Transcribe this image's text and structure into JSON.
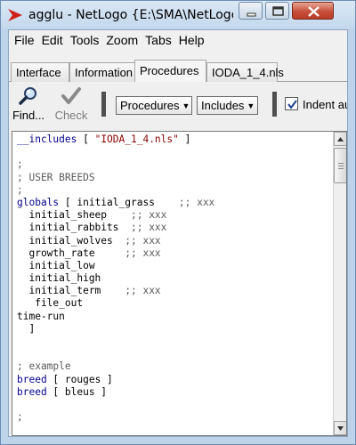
{
  "window": {
    "title": "agglu - NetLogo {E:\\SMA\\NetLogo",
    "buttons": {
      "minimize": "minimize-icon",
      "maximize": "maximize-icon",
      "close": "close-icon"
    },
    "colors": {
      "titlebar": "#c3d7ec",
      "close": "#c7503b",
      "app_icon": "#d0201a"
    }
  },
  "menu": {
    "items": [
      "File",
      "Edit",
      "Tools",
      "Zoom",
      "Tabs",
      "Help"
    ]
  },
  "tabs": {
    "items": [
      "Interface",
      "Information",
      "Procedures",
      "IODA_1_4.nls"
    ],
    "active": "Procedures"
  },
  "toolbar": {
    "find_label": "Find...",
    "check_label": "Check",
    "procedures_dropdown": "Procedures",
    "includes_dropdown": "Includes",
    "indent_label": "Indent automatically",
    "indent_checked": true
  },
  "editor": {
    "lines": [
      [
        {
          "t": "__includes",
          "c": "kw"
        },
        {
          "t": " [ ",
          "c": ""
        },
        {
          "t": "\"IODA_1_4.nls\"",
          "c": "str"
        },
        {
          "t": " ]",
          "c": ""
        }
      ],
      [],
      [
        {
          "t": ";",
          "c": "cm"
        }
      ],
      [
        {
          "t": "; USER BREEDS",
          "c": "cm"
        }
      ],
      [
        {
          "t": ";",
          "c": "cm"
        }
      ],
      [
        {
          "t": "globals",
          "c": "kw"
        },
        {
          "t": " [ initial_grass    ",
          "c": ""
        },
        {
          "t": ";; xxx",
          "c": "cm"
        }
      ],
      [
        {
          "t": "  initial_sheep    ",
          "c": ""
        },
        {
          "t": ";; xxx",
          "c": "cm"
        }
      ],
      [
        {
          "t": "  initial_rabbits  ",
          "c": ""
        },
        {
          "t": ";; xxx",
          "c": "cm"
        }
      ],
      [
        {
          "t": "  initial_wolves  ",
          "c": ""
        },
        {
          "t": ";; xxx",
          "c": "cm"
        }
      ],
      [
        {
          "t": "  growth_rate     ",
          "c": ""
        },
        {
          "t": ";; xxx",
          "c": "cm"
        }
      ],
      [
        {
          "t": "  initial_low",
          "c": ""
        }
      ],
      [
        {
          "t": "  initial_high",
          "c": ""
        }
      ],
      [
        {
          "t": "  initial_term    ",
          "c": ""
        },
        {
          "t": ";; xxx",
          "c": "cm"
        }
      ],
      [
        {
          "t": "   file_out",
          "c": ""
        }
      ],
      [
        {
          "t": "time-run",
          "c": ""
        }
      ],
      [
        {
          "t": "  ]",
          "c": ""
        }
      ],
      [],
      [],
      [
        {
          "t": "; example",
          "c": "cm"
        }
      ],
      [
        {
          "t": "breed",
          "c": "kw"
        },
        {
          "t": " [ rouges ]",
          "c": ""
        }
      ],
      [
        {
          "t": "breed",
          "c": "kw"
        },
        {
          "t": " [ bleus ]",
          "c": ""
        }
      ],
      [],
      [
        {
          "t": ";",
          "c": "cm"
        }
      ]
    ],
    "colors": {
      "keyword": "#00008b",
      "string": "#8b0000",
      "comment": "#5a5a5a"
    }
  }
}
